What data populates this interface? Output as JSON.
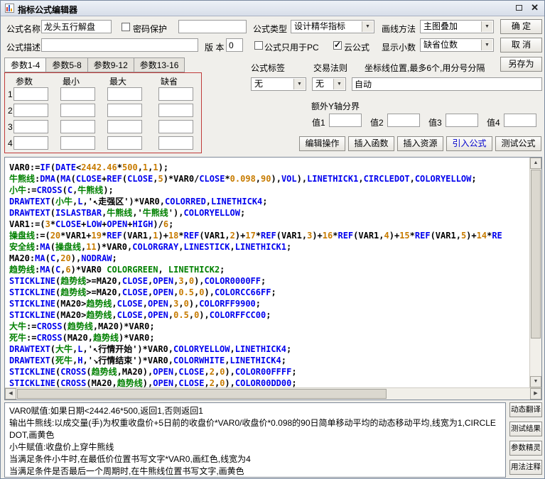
{
  "colors": {
    "keyword_blue": "#0000EE",
    "identifier_green": "#008000",
    "number_orange": "#C77B00",
    "accent_blue": "#0000CC",
    "red_border": "#C03A3A"
  },
  "window": {
    "title": "指标公式编辑器"
  },
  "form": {
    "name_label": "公式名称",
    "name_value": "龙头五行解盘",
    "password_label": "密码保护",
    "password_value": "",
    "type_label": "公式类型",
    "type_value": "设计精华指标",
    "draw_label": "画线方法",
    "draw_value": "主图叠加",
    "ok_label": "确 定",
    "desc_label": "公式描述",
    "desc_value": "",
    "version_label": "版 本",
    "version_value": "0",
    "pc_only_label": "公式只用于PC",
    "cloud_label": "云公式",
    "cloud_checked": true,
    "decimal_label": "显示小数",
    "decimal_value": "缺省位数",
    "cancel_label": "取 消",
    "save_as_label": "另存为"
  },
  "tabs": {
    "labels": [
      "参数1-4",
      "参数5-8",
      "参数9-12",
      "参数13-16"
    ],
    "active_index": 0
  },
  "param_table": {
    "headers": [
      "参数",
      "最小",
      "最大",
      "缺省"
    ],
    "row_numbers": [
      "1",
      "2",
      "3",
      "4"
    ]
  },
  "tagrule": {
    "tag_label": "公式标签",
    "tag_value": "无",
    "rule_label": "交易法则",
    "rule_value": "无",
    "coord_label": "坐标线位置,最多6个,用分号分隔",
    "coord_value": "自动"
  },
  "y_axis": {
    "title": "额外Y轴分界",
    "fields": [
      "值1",
      "值2",
      "值3",
      "值4"
    ]
  },
  "action_buttons": [
    {
      "label": "编辑操作",
      "name": "edit-operation-button",
      "accent": false
    },
    {
      "label": "插入函数",
      "name": "insert-function-button",
      "accent": false
    },
    {
      "label": "插入资源",
      "name": "insert-resource-button",
      "accent": false
    },
    {
      "label": "引入公式",
      "name": "import-formula-button",
      "accent": true
    },
    {
      "label": "测试公式",
      "name": "test-formula-button",
      "accent": false
    }
  ],
  "code": {
    "lines": [
      [
        [
          "p",
          "VAR0:="
        ],
        [
          "k",
          "IF"
        ],
        [
          "p",
          "("
        ],
        [
          "k",
          "DATE"
        ],
        [
          "p",
          "<"
        ],
        [
          "n",
          "2442.46"
        ],
        [
          "p",
          "*"
        ],
        [
          "n",
          "500"
        ],
        [
          "p",
          ","
        ],
        [
          "n",
          "1"
        ],
        [
          "p",
          ","
        ],
        [
          "n",
          "1"
        ],
        [
          "p",
          ");"
        ]
      ],
      [
        [
          "g",
          "牛熊线"
        ],
        [
          "p",
          ":"
        ],
        [
          "k",
          "DMA"
        ],
        [
          "p",
          "("
        ],
        [
          "k",
          "MA"
        ],
        [
          "p",
          "("
        ],
        [
          "k",
          "CLOSE"
        ],
        [
          "p",
          "+"
        ],
        [
          "k",
          "REF"
        ],
        [
          "p",
          "("
        ],
        [
          "k",
          "CLOSE"
        ],
        [
          "p",
          ","
        ],
        [
          "n",
          "5"
        ],
        [
          "p",
          ")*VAR0/"
        ],
        [
          "k",
          "CLOSE"
        ],
        [
          "p",
          "*"
        ],
        [
          "n",
          "0.098"
        ],
        [
          "p",
          ","
        ],
        [
          "n",
          "90"
        ],
        [
          "p",
          "),"
        ],
        [
          "k",
          "VOL"
        ],
        [
          "p",
          "),"
        ],
        [
          "k",
          "LINETHICK1"
        ],
        [
          "p",
          ","
        ],
        [
          "k",
          "CIRCLEDOT"
        ],
        [
          "p",
          ","
        ],
        [
          "k",
          "COLORYELLOW"
        ],
        [
          "p",
          ";"
        ]
      ],
      [
        [
          "g",
          "小牛"
        ],
        [
          "p",
          ":="
        ],
        [
          "k",
          "CROSS"
        ],
        [
          "p",
          "("
        ],
        [
          "k",
          "C"
        ],
        [
          "p",
          ","
        ],
        [
          "g",
          "牛熊线"
        ],
        [
          "p",
          ");"
        ]
      ],
      [
        [
          "k",
          "DRAWTEXT"
        ],
        [
          "p",
          "("
        ],
        [
          "g",
          "小牛"
        ],
        [
          "p",
          ","
        ],
        [
          "k",
          "L"
        ],
        [
          "p",
          ",'↖走强区')*VAR0,"
        ],
        [
          "k",
          "COLORRED"
        ],
        [
          "p",
          ","
        ],
        [
          "k",
          "LINETHICK4"
        ],
        [
          "p",
          ";"
        ]
      ],
      [
        [
          "k",
          "DRAWTEXT"
        ],
        [
          "p",
          "("
        ],
        [
          "k",
          "ISLASTBAR"
        ],
        [
          "p",
          ","
        ],
        [
          "g",
          "牛熊线"
        ],
        [
          "p",
          ",'"
        ],
        [
          "g",
          "牛熊线"
        ],
        [
          "p",
          "'),"
        ],
        [
          "k",
          "COLORYELLOW"
        ],
        [
          "p",
          ";"
        ]
      ],
      [
        [
          "p",
          "VAR1:=("
        ],
        [
          "n",
          "3"
        ],
        [
          "p",
          "*"
        ],
        [
          "k",
          "CLOSE"
        ],
        [
          "p",
          "+"
        ],
        [
          "k",
          "LOW"
        ],
        [
          "p",
          "+"
        ],
        [
          "k",
          "OPEN"
        ],
        [
          "p",
          "+"
        ],
        [
          "k",
          "HIGH"
        ],
        [
          "p",
          ")/"
        ],
        [
          "n",
          "6"
        ],
        [
          "p",
          ";"
        ]
      ],
      [
        [
          "g",
          "操盘线"
        ],
        [
          "p",
          ":=("
        ],
        [
          "n",
          "20"
        ],
        [
          "p",
          "*VAR1+"
        ],
        [
          "n",
          "19"
        ],
        [
          "p",
          "*"
        ],
        [
          "k",
          "REF"
        ],
        [
          "p",
          "(VAR1,"
        ],
        [
          "n",
          "1"
        ],
        [
          "p",
          ")+"
        ],
        [
          "n",
          "18"
        ],
        [
          "p",
          "*"
        ],
        [
          "k",
          "REF"
        ],
        [
          "p",
          "(VAR1,"
        ],
        [
          "n",
          "2"
        ],
        [
          "p",
          ")+"
        ],
        [
          "n",
          "17"
        ],
        [
          "p",
          "*"
        ],
        [
          "k",
          "REF"
        ],
        [
          "p",
          "(VAR1,"
        ],
        [
          "n",
          "3"
        ],
        [
          "p",
          ")+"
        ],
        [
          "n",
          "16"
        ],
        [
          "p",
          "*"
        ],
        [
          "k",
          "REF"
        ],
        [
          "p",
          "(VAR1,"
        ],
        [
          "n",
          "4"
        ],
        [
          "p",
          ")+"
        ],
        [
          "n",
          "15"
        ],
        [
          "p",
          "*"
        ],
        [
          "k",
          "REF"
        ],
        [
          "p",
          "(VAR1,"
        ],
        [
          "n",
          "5"
        ],
        [
          "p",
          ")+"
        ],
        [
          "n",
          "14"
        ],
        [
          "p",
          "*"
        ],
        [
          "k",
          "RE"
        ]
      ],
      [
        [
          "g",
          "安全线"
        ],
        [
          "p",
          ":"
        ],
        [
          "k",
          "MA"
        ],
        [
          "p",
          "("
        ],
        [
          "g",
          "操盘线"
        ],
        [
          "p",
          ","
        ],
        [
          "n",
          "11"
        ],
        [
          "p",
          ")*VAR0,"
        ],
        [
          "k",
          "COLORGRAY"
        ],
        [
          "p",
          ","
        ],
        [
          "k",
          "LINESTICK"
        ],
        [
          "p",
          ","
        ],
        [
          "k",
          "LINETHICK1"
        ],
        [
          "p",
          ";"
        ]
      ],
      [
        [
          "p",
          "MA20:"
        ],
        [
          "k",
          "MA"
        ],
        [
          "p",
          "("
        ],
        [
          "k",
          "C"
        ],
        [
          "p",
          ","
        ],
        [
          "n",
          "20"
        ],
        [
          "p",
          "),"
        ],
        [
          "k",
          "NODRAW"
        ],
        [
          "p",
          ";"
        ]
      ],
      [
        [
          "g",
          "趋势线"
        ],
        [
          "p",
          ":"
        ],
        [
          "k",
          "MA"
        ],
        [
          "p",
          "("
        ],
        [
          "k",
          "C"
        ],
        [
          "p",
          ","
        ],
        [
          "n",
          "6"
        ],
        [
          "p",
          ")*VAR0 "
        ],
        [
          "g",
          "COLORGREEN"
        ],
        [
          "p",
          ", "
        ],
        [
          "g",
          "LINETHICK2"
        ],
        [
          "p",
          ";"
        ]
      ],
      [
        [
          "k",
          "STICKLINE"
        ],
        [
          "p",
          "("
        ],
        [
          "g",
          "趋势线"
        ],
        [
          "p",
          ">=MA20,"
        ],
        [
          "k",
          "CLOSE"
        ],
        [
          "p",
          ","
        ],
        [
          "k",
          "OPEN"
        ],
        [
          "p",
          ","
        ],
        [
          "n",
          "3"
        ],
        [
          "p",
          ","
        ],
        [
          "n",
          "0"
        ],
        [
          "p",
          "),"
        ],
        [
          "k",
          "COLOR0000FF"
        ],
        [
          "p",
          ";"
        ]
      ],
      [
        [
          "k",
          "STICKLINE"
        ],
        [
          "p",
          "("
        ],
        [
          "g",
          "趋势线"
        ],
        [
          "p",
          ">=MA20,"
        ],
        [
          "k",
          "CLOSE"
        ],
        [
          "p",
          ","
        ],
        [
          "k",
          "OPEN"
        ],
        [
          "p",
          ","
        ],
        [
          "n",
          "0.5"
        ],
        [
          "p",
          ","
        ],
        [
          "n",
          "0"
        ],
        [
          "p",
          "),"
        ],
        [
          "k",
          "COLORCC66FF"
        ],
        [
          "p",
          ";"
        ]
      ],
      [
        [
          "k",
          "STICKLINE"
        ],
        [
          "p",
          "(MA20>"
        ],
        [
          "g",
          "趋势线"
        ],
        [
          "p",
          ","
        ],
        [
          "k",
          "CLOSE"
        ],
        [
          "p",
          ","
        ],
        [
          "k",
          "OPEN"
        ],
        [
          "p",
          ","
        ],
        [
          "n",
          "3"
        ],
        [
          "p",
          ","
        ],
        [
          "n",
          "0"
        ],
        [
          "p",
          "),"
        ],
        [
          "k",
          "COLORFF9900"
        ],
        [
          "p",
          ";"
        ]
      ],
      [
        [
          "k",
          "STICKLINE"
        ],
        [
          "p",
          "(MA20>"
        ],
        [
          "g",
          "趋势线"
        ],
        [
          "p",
          ","
        ],
        [
          "k",
          "CLOSE"
        ],
        [
          "p",
          ","
        ],
        [
          "k",
          "OPEN"
        ],
        [
          "p",
          ","
        ],
        [
          "n",
          "0.5"
        ],
        [
          "p",
          ","
        ],
        [
          "n",
          "0"
        ],
        [
          "p",
          "),"
        ],
        [
          "k",
          "COLORFFCC00"
        ],
        [
          "p",
          ";"
        ]
      ],
      [
        [
          "g",
          "大牛"
        ],
        [
          "p",
          ":="
        ],
        [
          "k",
          "CROSS"
        ],
        [
          "p",
          "("
        ],
        [
          "g",
          "趋势线"
        ],
        [
          "p",
          ",MA20)*VAR0;"
        ]
      ],
      [
        [
          "g",
          "死牛"
        ],
        [
          "p",
          ":="
        ],
        [
          "k",
          "CROSS"
        ],
        [
          "p",
          "(MA20,"
        ],
        [
          "g",
          "趋势线"
        ],
        [
          "p",
          ")*VAR0;"
        ]
      ],
      [
        [
          "k",
          "DRAWTEXT"
        ],
        [
          "p",
          "("
        ],
        [
          "g",
          "大牛"
        ],
        [
          "p",
          ","
        ],
        [
          "k",
          "L"
        ],
        [
          "p",
          ",'↖行情开始')*VAR0,"
        ],
        [
          "k",
          "COLORYELLOW"
        ],
        [
          "p",
          ","
        ],
        [
          "k",
          "LINETHICK4"
        ],
        [
          "p",
          ";"
        ]
      ],
      [
        [
          "k",
          "DRAWTEXT"
        ],
        [
          "p",
          "("
        ],
        [
          "g",
          "死牛"
        ],
        [
          "p",
          ","
        ],
        [
          "k",
          "H"
        ],
        [
          "p",
          ",'↘行情结束')*VAR0,"
        ],
        [
          "k",
          "COLORWHITE"
        ],
        [
          "p",
          ","
        ],
        [
          "k",
          "LINETHICK4"
        ],
        [
          "p",
          ";"
        ]
      ],
      [
        [
          "k",
          "STICKLINE"
        ],
        [
          "p",
          "("
        ],
        [
          "k",
          "CROSS"
        ],
        [
          "p",
          "("
        ],
        [
          "g",
          "趋势线"
        ],
        [
          "p",
          ",MA20),"
        ],
        [
          "k",
          "OPEN"
        ],
        [
          "p",
          ","
        ],
        [
          "k",
          "CLOSE"
        ],
        [
          "p",
          ","
        ],
        [
          "n",
          "2"
        ],
        [
          "p",
          ","
        ],
        [
          "n",
          "0"
        ],
        [
          "p",
          "),"
        ],
        [
          "k",
          "COLOR00FFFF"
        ],
        [
          "p",
          ";"
        ]
      ],
      [
        [
          "k",
          "STICKLINE"
        ],
        [
          "p",
          "("
        ],
        [
          "k",
          "CROSS"
        ],
        [
          "p",
          "(MA20,"
        ],
        [
          "g",
          "趋势线"
        ],
        [
          "p",
          "),"
        ],
        [
          "k",
          "OPEN"
        ],
        [
          "p",
          ","
        ],
        [
          "k",
          "CLOSE"
        ],
        [
          "p",
          ","
        ],
        [
          "n",
          "2"
        ],
        [
          "p",
          ","
        ],
        [
          "n",
          "0"
        ],
        [
          "p",
          "),"
        ],
        [
          "k",
          "COLOR00DD00"
        ],
        [
          "p",
          ";"
        ]
      ]
    ]
  },
  "translation": {
    "lines": [
      "VAR0赋值:如果日期<2442.46*500,返回1,否则返回1",
      "输出牛熊线:以成交量(手)为权重收盘价+5日前的收盘价*VAR0/收盘价*0.098的90日简单移动平均的动态移动平均,线宽为1,CIRCLEDOT,画黄色",
      "小牛赋值:收盘价上穿牛熊线",
      "当满足条件小牛时,在最低价位置书写文字*VAR0,画红色,线宽为4",
      "当满足条件是否最后一个周期时,在牛熊线位置书写文字,画黄色"
    ]
  },
  "side_buttons": [
    {
      "label": "动态翻译",
      "name": "dynamic-translate-button"
    },
    {
      "label": "测试结果",
      "name": "test-result-button"
    },
    {
      "label": "参数精灵",
      "name": "param-wizard-button"
    },
    {
      "label": "用法注释",
      "name": "usage-notes-button"
    }
  ]
}
